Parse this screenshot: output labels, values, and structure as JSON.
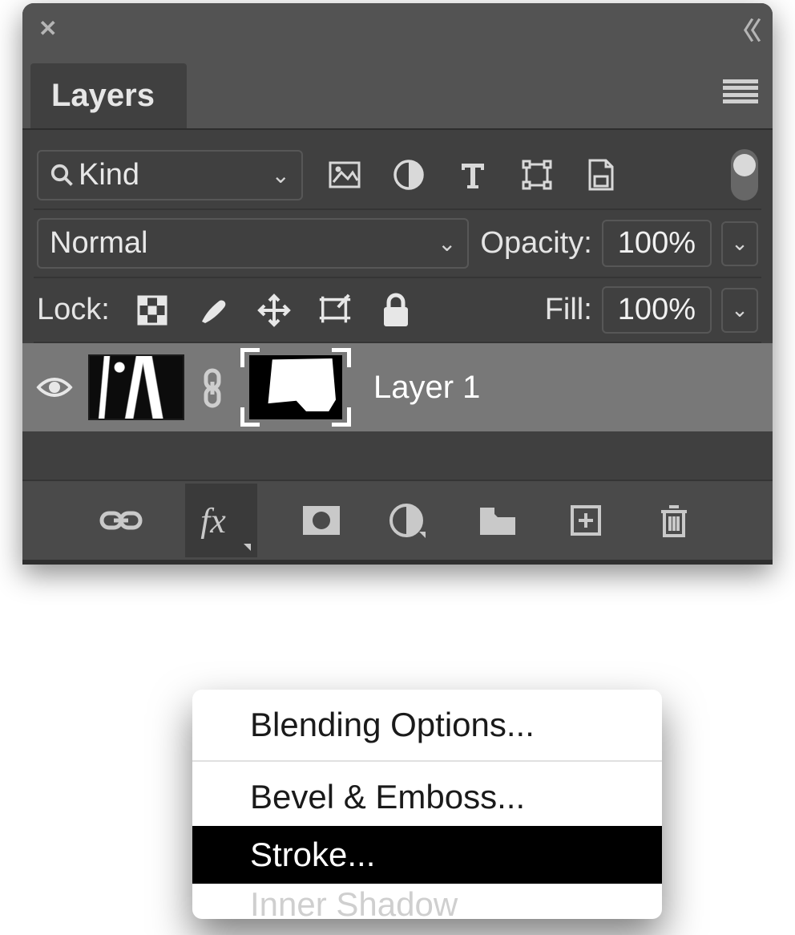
{
  "panel": {
    "title": "Layers"
  },
  "filter": {
    "mode": "Kind"
  },
  "blend": {
    "mode": "Normal",
    "opacity_label": "Opacity:",
    "opacity_value": "100%"
  },
  "lock": {
    "label": "Lock:",
    "fill_label": "Fill:",
    "fill_value": "100%"
  },
  "layers": [
    {
      "name": "Layer 1"
    }
  ],
  "fx_menu": {
    "blending": "Blending Options...",
    "bevel": "Bevel & Emboss...",
    "stroke": "Stroke...",
    "inner_shadow": "Inner Shadow"
  },
  "icons": {
    "filter_pixel": "image-icon",
    "filter_adjust": "adjustment-icon",
    "filter_type": "type-icon",
    "filter_shape": "shape-icon",
    "filter_smart": "smartobject-icon"
  }
}
